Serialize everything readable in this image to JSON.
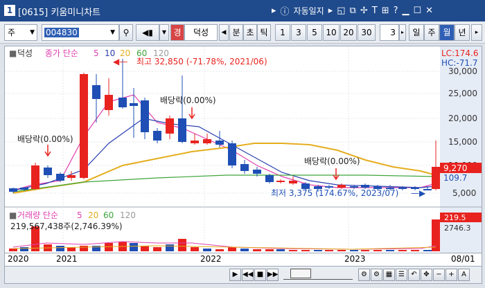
{
  "window": {
    "number": "1",
    "title": "[0615] 키움미니차트",
    "menu_label": "자동일지"
  },
  "toolbar": {
    "market": "주",
    "code": "004830",
    "chart_name": "덕성",
    "stock_badge": "경",
    "btn_tick_labels": [
      "분",
      "초",
      "틱"
    ],
    "interval_buttons": [
      "1",
      "3",
      "5",
      "10",
      "20",
      "30"
    ],
    "spin_value": "3",
    "period_buttons": [
      "일",
      "주",
      "월",
      "년"
    ],
    "active_period": "월"
  },
  "chart": {
    "legend_name": "덕성",
    "legend_close": "종가 단순",
    "ma_periods": [
      "5",
      "10",
      "20",
      "60",
      "120"
    ],
    "right_top": [
      "LC:174.6",
      "HC:-71.7"
    ],
    "y_ticks": [
      "30,000",
      "25,000",
      "20,000",
      "15,000",
      "10,000",
      "5,000"
    ],
    "price_label": "9,270",
    "price_label2": "109.7",
    "high_annot": "최고 32,850 (-71.78%, 2021/06)",
    "low_annot": "최저 3,375 (174.67%, 2023/07)",
    "div1": "배당락(0.00%)",
    "div2": "배당락(0.00%)",
    "div3": "배당락(0.00%)",
    "vol_legend": "거래량  단순",
    "vol_ma": [
      "5",
      "20",
      "60",
      "120"
    ],
    "vol_value": "219,567,438주(2,746.39%)",
    "vol_label": "219.5",
    "vol_label2": "2746.3",
    "x_labels": [
      "2020",
      "2021",
      "2022",
      "2023",
      "08/01"
    ]
  },
  "colors": {
    "up": "#e8231f",
    "down": "#1f4fb5",
    "ma5": "#e03fae",
    "ma10": "#2a3fb0",
    "ma20": "#e5ad1d",
    "ma60": "#3ea53a",
    "ma120": "#9a9a9a"
  }
}
